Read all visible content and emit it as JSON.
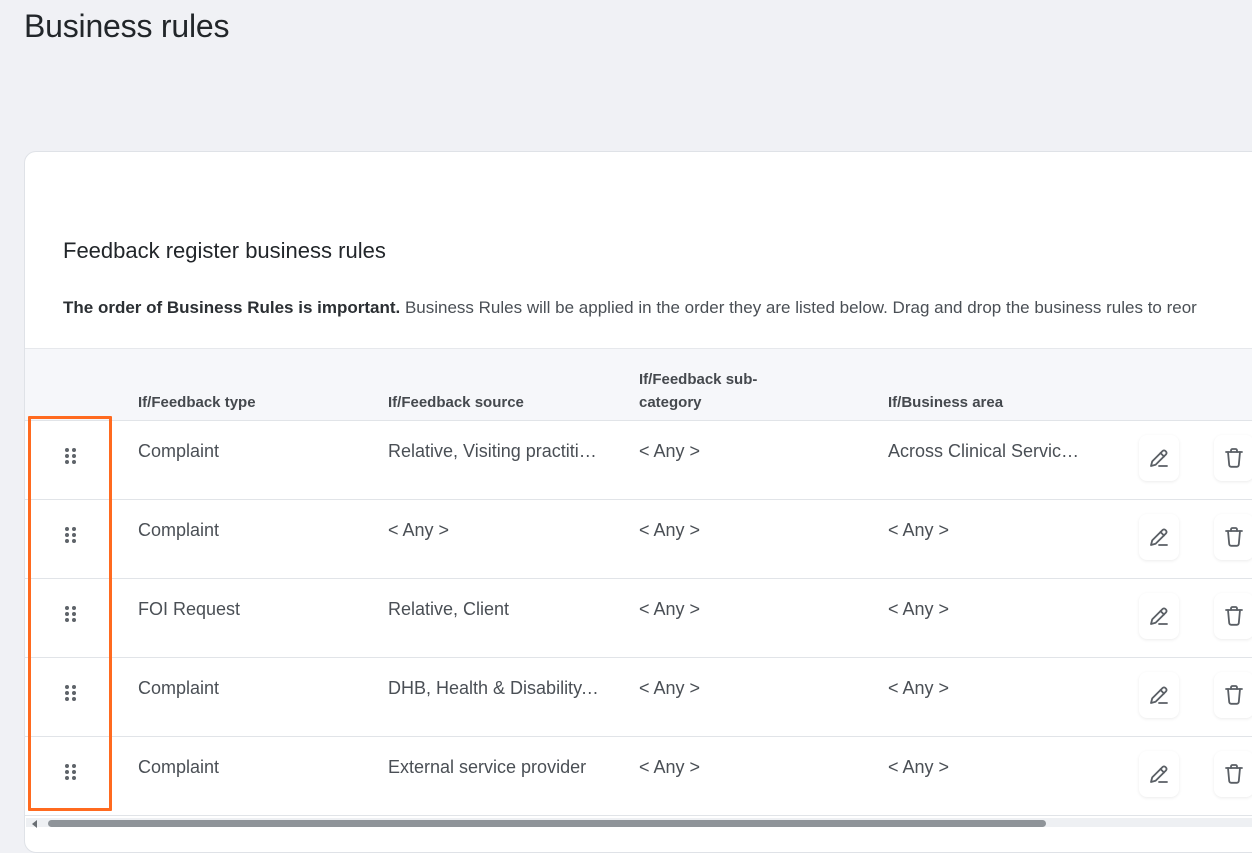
{
  "page": {
    "title": "Business rules"
  },
  "card": {
    "title": "Feedback register business rules",
    "notice_bold": "The order of Business Rules is important.",
    "notice_text": " Business Rules will be applied in the order they are listed below. Drag and drop the business rules to reor"
  },
  "table": {
    "headers": {
      "feedback_type": "If/Feedback type",
      "feedback_source": "If/Feedback source",
      "feedback_subcategory_line1": "If/Feedback sub-",
      "feedback_subcategory_line2": "category",
      "business_area": "If/Business area"
    },
    "rows": [
      {
        "type": "Complaint",
        "source": "Relative, Visiting practitioner",
        "subcategory": "< Any >",
        "area": "Across Clinical Services and more"
      },
      {
        "type": "Complaint",
        "source": "< Any >",
        "subcategory": "< Any >",
        "area": "< Any >"
      },
      {
        "type": "FOI Request",
        "source": "Relative, Client",
        "subcategory": "< Any >",
        "area": "< Any >"
      },
      {
        "type": "Complaint",
        "source": "DHB, Health & Disability, Other",
        "subcategory": "< Any >",
        "area": "< Any >"
      },
      {
        "type": "Complaint",
        "source": "External service provider",
        "subcategory": "< Any >",
        "area": "< Any >"
      }
    ]
  },
  "icons": {
    "drag": "drag-handle-icon",
    "edit": "pencil-icon",
    "delete": "trash-icon"
  },
  "colors": {
    "highlight": "#ff6a1f",
    "background": "#f0f1f5"
  }
}
